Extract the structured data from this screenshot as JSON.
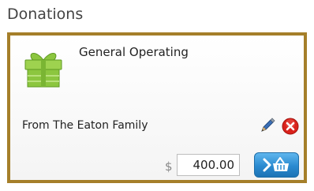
{
  "section": {
    "title": "Donations"
  },
  "donation": {
    "fund_name": "General Operating",
    "donor_line": "From The Eaton Family",
    "currency_symbol": "$",
    "amount": "400.00"
  },
  "icons": {
    "fund": "gift-icon",
    "edit": "pencil-icon",
    "delete": "delete-icon",
    "add_to_cart": "basket-icon"
  },
  "colors": {
    "card_border": "#a57f2a",
    "gift_green": "#8cc63f",
    "delete_red": "#d9221b",
    "button_blue": "#2a8ad0"
  }
}
